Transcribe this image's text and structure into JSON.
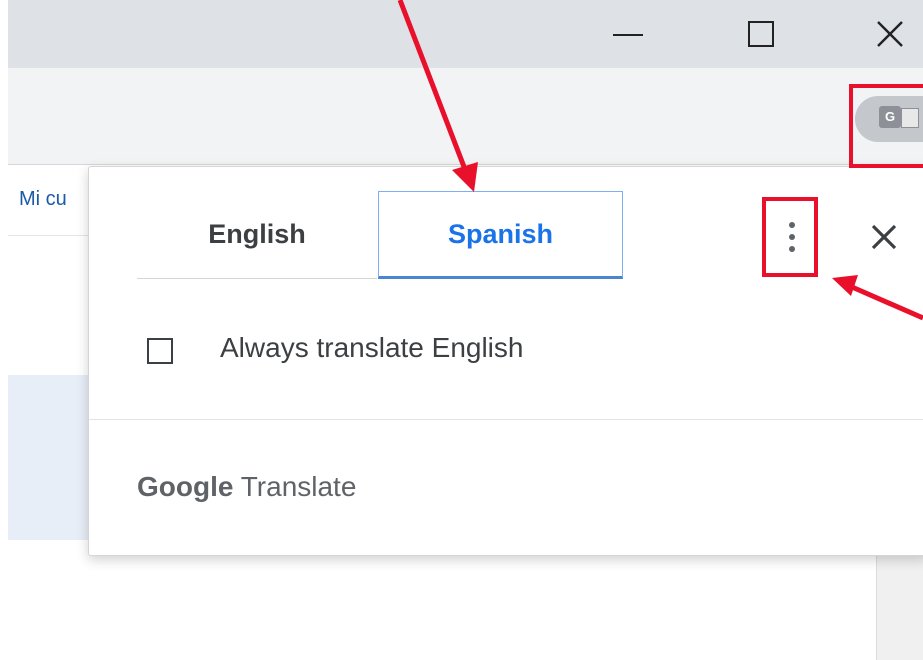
{
  "window_controls": {
    "minimize_icon": "minimize-icon",
    "maximize_icon": "maximize-icon",
    "close_icon": "close-window-icon"
  },
  "bookmarks_bar": {
    "partial_label": "Mi cu"
  },
  "translate_popup": {
    "tabs": [
      {
        "label": "English",
        "selected": false
      },
      {
        "label": "Spanish",
        "selected": true
      }
    ],
    "checkbox_label": "Always translate English",
    "checkbox_checked": false,
    "footer": {
      "brand_google": "Google",
      "brand_product": "Translate"
    }
  },
  "annotations": {
    "highlight_color": "#e8102b",
    "arrow_color": "#e8102b"
  },
  "colors": {
    "titlebar": "#dee1e6",
    "toolbar": "#f1f3f4",
    "accent": "#1a73e8"
  }
}
